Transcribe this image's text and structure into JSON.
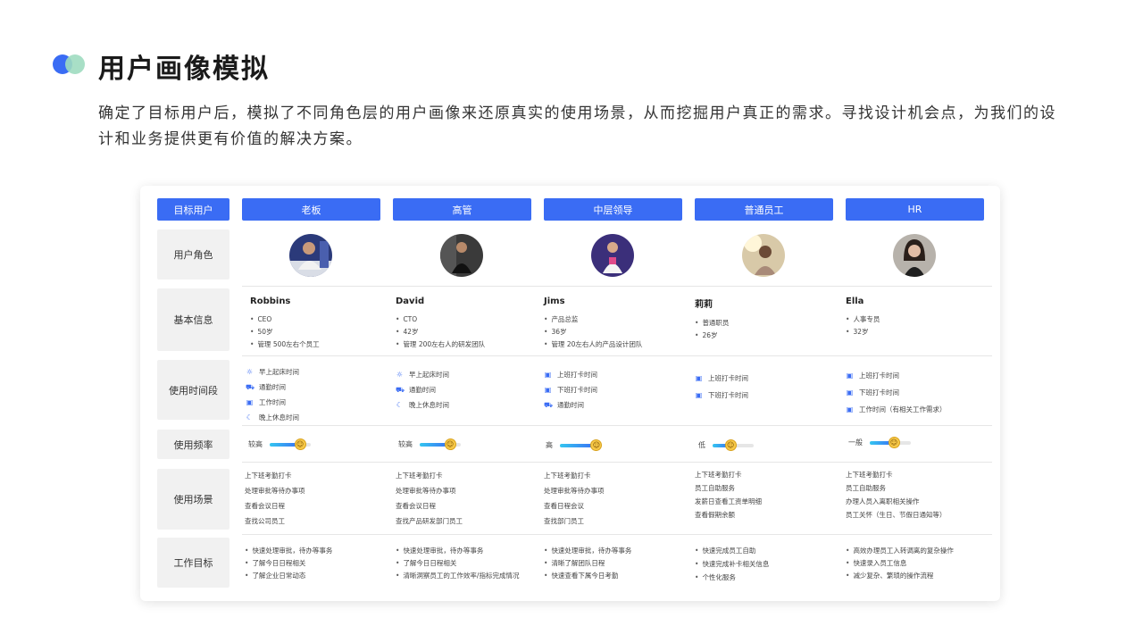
{
  "page": {
    "title": "用户画像模拟",
    "description": "确定了目标用户后，模拟了不同角色层的用户画像来还原真实的使用场景，从而挖掘用户真正的需求。寻找设计机会点，为我们的设计和业务提供更有价值的解决方案。"
  },
  "table": {
    "corner": "目标用户",
    "columns": [
      "老板",
      "高管",
      "中层领导",
      "普通员工",
      "HR"
    ],
    "row_labels": {
      "role": "用户角色",
      "info": "基本信息",
      "time": "使用时间段",
      "freq": "使用频率",
      "scene": "使用场景",
      "goal": "工作目标"
    },
    "info": [
      {
        "name": "Robbins",
        "items": [
          "CEO",
          "50岁",
          "管理 500左右个员工"
        ]
      },
      {
        "name": "David",
        "items": [
          "CTO",
          "42岁",
          "管理 200左右人的研发团队"
        ]
      },
      {
        "name": "Jims",
        "items": [
          "产品总监",
          "36岁",
          "管理 20左右人的产品设计团队"
        ]
      },
      {
        "name": "莉莉",
        "items": [
          "普通职员",
          "26岁"
        ]
      },
      {
        "name": "Ella",
        "items": [
          "人事专员",
          "32岁"
        ]
      }
    ],
    "time": [
      [
        {
          "icon": "sun-icon",
          "text": "早上起床时间"
        },
        {
          "icon": "car-icon",
          "text": "通勤时间"
        },
        {
          "icon": "briefcase-icon",
          "text": "工作时间"
        },
        {
          "icon": "moon-icon",
          "text": "晚上休息时间"
        }
      ],
      [
        {
          "icon": "sun-icon",
          "text": "早上起床时间"
        },
        {
          "icon": "car-icon",
          "text": "通勤时间"
        },
        {
          "icon": "moon-icon",
          "text": "晚上休息时间"
        }
      ],
      [
        {
          "icon": "briefcase-icon",
          "text": "上班打卡时间"
        },
        {
          "icon": "briefcase-icon",
          "text": "下班打卡时间"
        },
        {
          "icon": "car-icon",
          "text": "通勤时间"
        }
      ],
      [
        {
          "icon": "briefcase-icon",
          "text": "上班打卡时间"
        },
        {
          "icon": "briefcase-icon",
          "text": "下班打卡时间"
        }
      ],
      [
        {
          "icon": "briefcase-icon",
          "text": "上班打卡时间"
        },
        {
          "icon": "briefcase-icon",
          "text": "下班打卡时间"
        },
        {
          "icon": "briefcase-icon",
          "text": "工作时间（有相关工作需求）"
        }
      ]
    ],
    "freq": [
      {
        "label": "较高",
        "level": 0.75
      },
      {
        "label": "较高",
        "level": 0.75
      },
      {
        "label": "高",
        "level": 0.9
      },
      {
        "label": "低",
        "level": 0.45
      },
      {
        "label": "一般",
        "level": 0.6
      }
    ],
    "scene": [
      [
        "上下班考勤打卡",
        "处理审批等待办事项",
        "查看会议日程",
        "查找公司员工"
      ],
      [
        "上下班考勤打卡",
        "处理审批等待办事项",
        "查看会议日程",
        "查找产品研发部门员工"
      ],
      [
        "上下班考勤打卡",
        "处理审批等待办事项",
        "查看日程会议",
        "查找部门员工"
      ],
      [
        "上下班考勤打卡",
        "员工自助服务",
        "发薪日查看工资单明细",
        "查看假期余额"
      ],
      [
        "上下班考勤打卡",
        "员工自助服务",
        "办理人员入离职相关操作",
        "员工关怀（生日、节假日通知等）"
      ]
    ],
    "goal": [
      [
        "快速处理审批，待办等事务",
        "了解今日日程相关",
        "了解企业日常动态"
      ],
      [
        "快速处理审批，待办等事务",
        "了解今日日程相关",
        "清晰洞察员工的工作效率/指标完成情况"
      ],
      [
        "快速处理审批，待办等事务",
        "清晰了解团队日程",
        "快速查看下属今日考勤"
      ],
      [
        "快速完成员工自助",
        "快速完成补卡相关信息",
        "个性化服务"
      ],
      [
        "高效办理员工入转调离的复杂操作",
        "快速录入员工信息",
        "减少复杂、繁琐的操作流程"
      ]
    ]
  },
  "colors": {
    "accent": "#3a6cf4",
    "accent_green": "#9fdcc0",
    "label_bg": "#f1f1f1"
  }
}
